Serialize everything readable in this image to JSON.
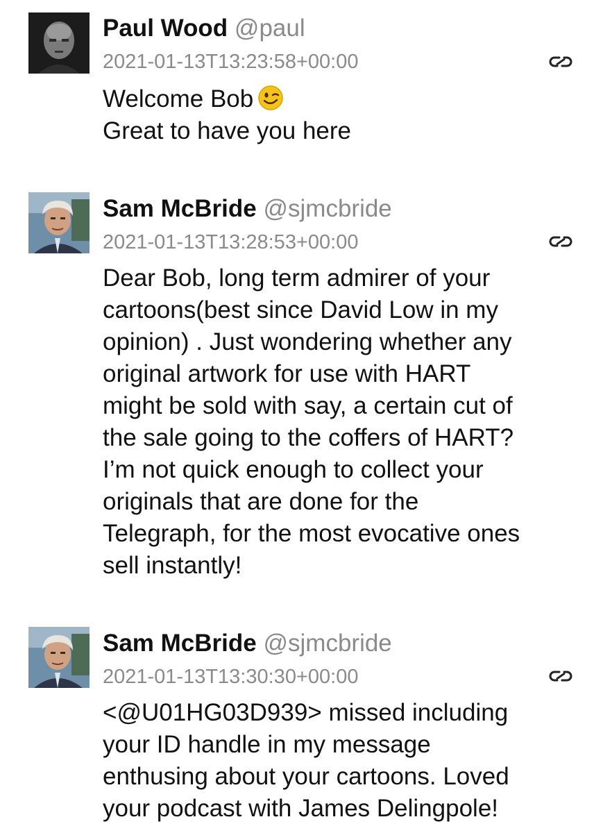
{
  "posts": [
    {
      "author_name": "Paul Wood",
      "author_handle": "@paul",
      "timestamp": "2021-01-13T13:23:58+00:00",
      "avatar_icon": "bald-man-portrait",
      "permalink_icon": "link-icon",
      "lines": [
        "Welcome Bob",
        "Great to have you here"
      ],
      "emoji": "winking-face-emoji"
    },
    {
      "author_name": "Sam McBride",
      "author_handle": "@sjmcbride",
      "timestamp": "2021-01-13T13:28:53+00:00",
      "avatar_icon": "man-portrait",
      "permalink_icon": "link-icon",
      "lines": [
        "Dear Bob, long term admirer of your",
        "cartoons(best since David Low in my",
        "opinion) . Just wondering whether any",
        "original artwork for use with HART",
        "might be sold with say, a certain cut of",
        "the sale going to the coffers of HART?",
        "I’m not quick enough to collect your",
        "originals that are done for the",
        "Telegraph, for the most evocative ones",
        "sell instantly!"
      ]
    },
    {
      "author_name": "Sam McBride",
      "author_handle": "@sjmcbride",
      "timestamp": "2021-01-13T13:30:30+00:00",
      "avatar_icon": "man-portrait",
      "permalink_icon": "link-icon",
      "lines": [
        "<@U01HG03D939> missed including",
        "your ID handle in my message",
        "enthusing about your cartoons. Loved",
        "your podcast with James Delingpole!"
      ]
    }
  ]
}
